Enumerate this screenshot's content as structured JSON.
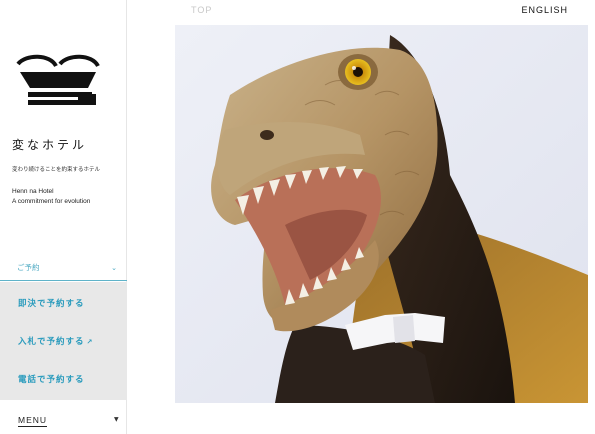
{
  "nav": {
    "top_label": "TOP",
    "language_label": "ENGLISH"
  },
  "brand": {
    "name_jp": "変なホテル",
    "tagline_jp": "変わり続けることを約束するホテル",
    "name_en": "Henn na Hotel",
    "tagline_en": "A commitment for evolution"
  },
  "reservation": {
    "toggle_label": "ご予約",
    "items": [
      {
        "label": "即決で予約する",
        "external": false
      },
      {
        "label": "入札で予約する",
        "external": true
      },
      {
        "label": "電話で予約する",
        "external": false
      }
    ]
  },
  "menu": {
    "label": "MENU"
  },
  "colors": {
    "accent": "#2a9bbd",
    "menu_bg": "#e8e8e8",
    "nav_muted": "#c8c8c8"
  },
  "icons": {
    "logo": "hotel-logo-icon",
    "chevron": "chevron-down-icon",
    "external": "external-link-icon"
  }
}
